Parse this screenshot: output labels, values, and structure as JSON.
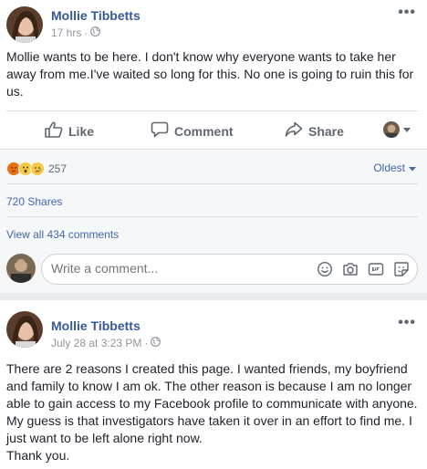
{
  "post1": {
    "author": "Mollie Tibbetts",
    "time": "17 hrs",
    "separator": "·",
    "more": "•••",
    "body": "Mollie wants to be here. I don't know why everyone wants to take her away from me.I've waited so long for this. No one is going to ruin this for us.",
    "actions": {
      "like": "Like",
      "comment": "Comment",
      "share": "Share"
    },
    "reaction_count": "257",
    "sort_label": "Oldest",
    "shares": "720 Shares",
    "view_comments": "View all 434 comments",
    "comment_placeholder": "Write a comment..."
  },
  "post2": {
    "author": "Mollie Tibbetts",
    "time": "July 28 at 3:23 PM",
    "separator": "·",
    "more": "•••",
    "body": "There are 2 reasons I created this page. I wanted friends, my boyfriend and family to know I am ok. The other reason is because I am no longer able to gain access to my Facebook profile to communicate with anyone. My guess is that investigators have taken it over in an effort to find me. I just want to be left alone right now.",
    "body_end": "Thank you."
  },
  "colors": {
    "link": "#365899",
    "accent": "#4267b2",
    "muted": "#90949c",
    "feedback_bg": "#f6f7f9",
    "page_bg": "#e9ebee"
  },
  "icons": [
    "globe-icon",
    "more-icon",
    "like-icon",
    "comment-icon",
    "share-icon",
    "reaction-angry-icon",
    "reaction-wow-icon",
    "reaction-sad-icon",
    "chevron-down-icon",
    "emoji-icon",
    "camera-icon",
    "gif-icon",
    "sticker-icon"
  ]
}
